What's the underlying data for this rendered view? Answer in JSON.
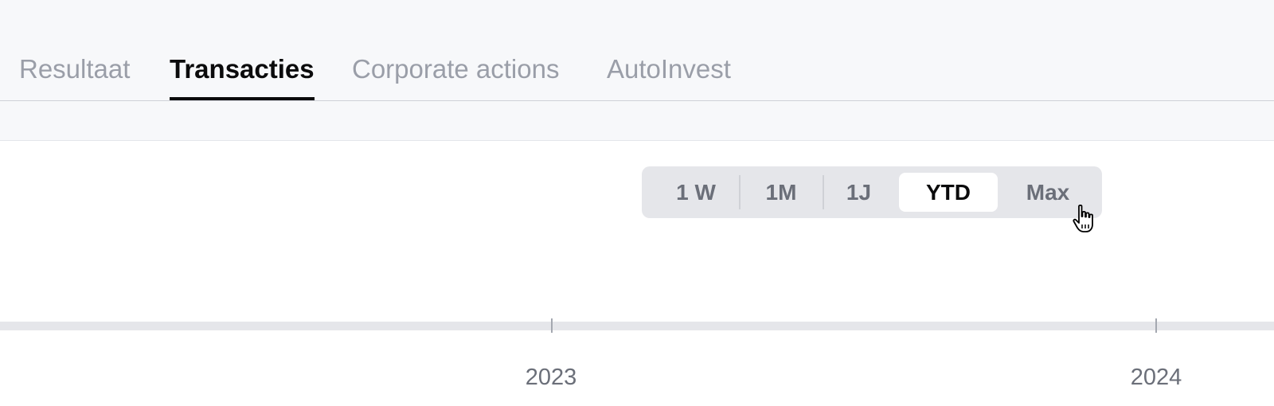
{
  "tabs": [
    {
      "label": "Resultaat",
      "active": false
    },
    {
      "label": "Transacties",
      "active": true
    },
    {
      "label": "Corporate actions",
      "active": false
    },
    {
      "label": "AutoInvest",
      "active": false
    }
  ],
  "range_selector": {
    "options": [
      "1 W",
      "1M",
      "1J",
      "YTD",
      "Max"
    ],
    "selected": "YTD"
  },
  "timeline": {
    "year_labels": [
      "2023",
      "2024"
    ]
  },
  "colors": {
    "background_top": "#f7f8fa",
    "tab_inactive": "#9a9ea8",
    "tab_active": "#0b0b0c",
    "segment_bg": "#e5e6ea",
    "segment_text": "#6b6f79"
  },
  "icons": {
    "cursor": "hand-pointer-icon"
  }
}
